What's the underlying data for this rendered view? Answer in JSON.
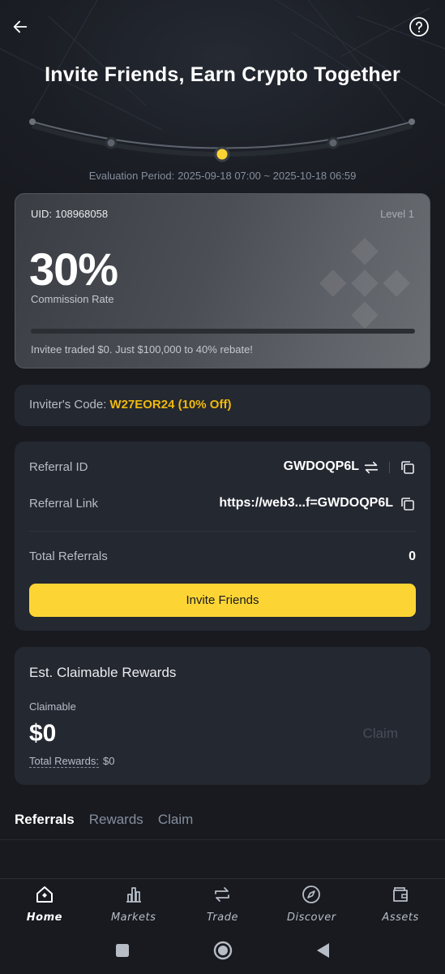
{
  "header": {
    "title": "Invite Friends, Earn Crypto Together",
    "back_icon": "arrow-left-icon",
    "help_icon": "question-circle-icon",
    "evaluation_label": "Evaluation Period:",
    "evaluation_range": "2025-09-18 07:00 ~ 2025-10-18 06:59"
  },
  "level_card": {
    "uid_label": "UID:",
    "uid": "108968058",
    "level": "Level 1",
    "rate": "30%",
    "rate_label": "Commission Rate",
    "progress_fraction": 0,
    "note": "Invitee traded $0. Just $100,000 to 40% rebate!"
  },
  "inviter": {
    "label": "Inviter's Code:",
    "code": "W27EOR24 (10% Off)"
  },
  "referral": {
    "id_label": "Referral ID",
    "id_value": "GWDOQP6L",
    "link_label": "Referral Link",
    "link_value": "https://web3...f=GWDOQP6L",
    "total_label": "Total Referrals",
    "total_value": "0",
    "invite_button": "Invite Friends"
  },
  "rewards": {
    "title": "Est. Claimable Rewards",
    "claimable_label": "Claimable",
    "claimable_amount": "$0",
    "claim_button": "Claim",
    "total_label": "Total Rewards:",
    "total_value": "$0"
  },
  "tabs": [
    {
      "label": "Referrals",
      "active": true
    },
    {
      "label": "Rewards",
      "active": false
    },
    {
      "label": "Claim",
      "active": false
    }
  ],
  "bottom_nav": [
    {
      "label": "Home",
      "icon": "home-icon",
      "active": true
    },
    {
      "label": "Markets",
      "icon": "bar-chart-icon",
      "active": false
    },
    {
      "label": "Trade",
      "icon": "swap-arrows-icon",
      "active": false
    },
    {
      "label": "Discover",
      "icon": "compass-icon",
      "active": false
    },
    {
      "label": "Assets",
      "icon": "wallet-icon",
      "active": false
    }
  ],
  "colors": {
    "background": "#181a20",
    "card": "#242831",
    "accent": "#fcd535",
    "code_color": "#f0b90b"
  }
}
